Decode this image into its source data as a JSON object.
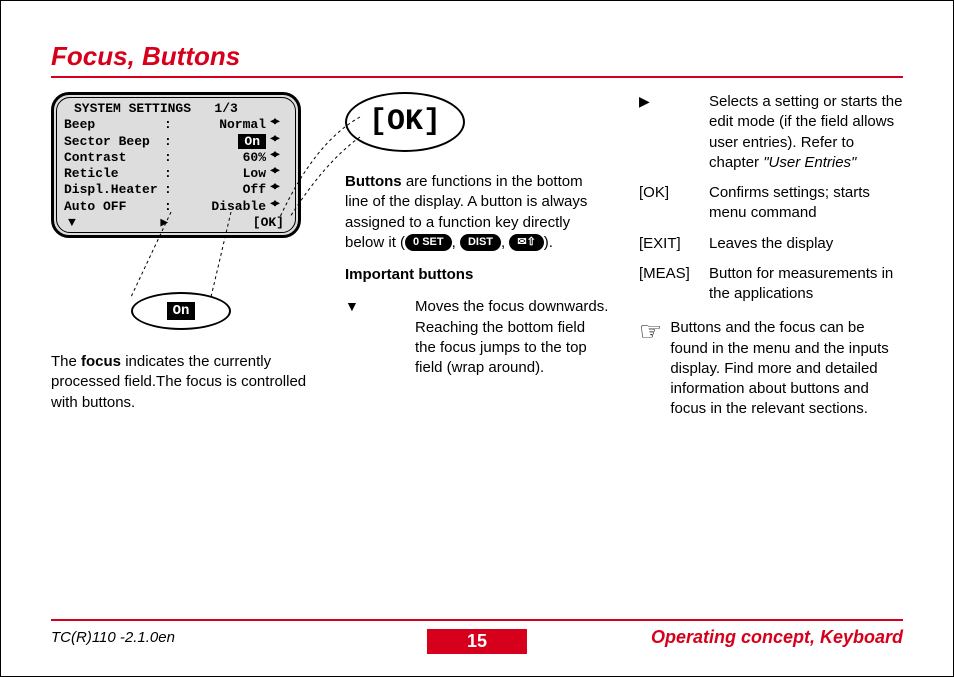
{
  "title": "Focus, Buttons",
  "lcd": {
    "header": "SYSTEM SETTINGS   1/3",
    "rows": [
      {
        "label": "Beep",
        "value": "Normal",
        "hl": false
      },
      {
        "label": "Sector Beep",
        "value": "On",
        "hl": true
      },
      {
        "label": "Contrast",
        "value": "60%",
        "hl": false
      },
      {
        "label": "Reticle",
        "value": "Low",
        "hl": false
      },
      {
        "label": "Displ.Heater",
        "value": "Off",
        "hl": false
      },
      {
        "label": "Auto OFF",
        "value": "Disable",
        "hl": false
      }
    ],
    "foot_left": "▼",
    "foot_mid": "▶",
    "foot_right": "[OK]"
  },
  "zoom_value": "On",
  "ok_bubble": "[OK]",
  "para_buttons_1": "Buttons",
  "para_buttons_2": " are functions in the bottom line of the display. A button is always assigned to a function key directly below it (",
  "para_buttons_3": ").",
  "keycaps": {
    "k1": "0 SET",
    "k2": "DIST",
    "k3": "✉⇧"
  },
  "important_heading": "Important buttons",
  "down_desc": "Moves the focus downwards. Reaching the bottom field the focus jumps to the top field (wrap around).",
  "focus_para_1": "The ",
  "focus_strong": "focus",
  "focus_para_2": " indicates the currently processed field.The focus is controlled with buttons.",
  "right_desc": "Selects a setting or starts the edit mode (if the field allows user entries). Refer to chapter ",
  "right_desc_em": "\"User Entries\"",
  "defs": {
    "ok_k": "[OK]",
    "ok_v": "Confirms settings; starts menu command",
    "exit_k": "[EXIT]",
    "exit_v": "Leaves the display",
    "meas_k": "[MEAS]",
    "meas_v": "Button for measurements in the applications"
  },
  "hand_para": "Buttons and the focus can be found in the menu and the inputs display. Find more and detailed information about buttons and focus in the relevant sections.",
  "footer_left": "TC(R)110 -2.1.0en",
  "page_number": "15",
  "footer_right": "Operating concept, Keyboard"
}
